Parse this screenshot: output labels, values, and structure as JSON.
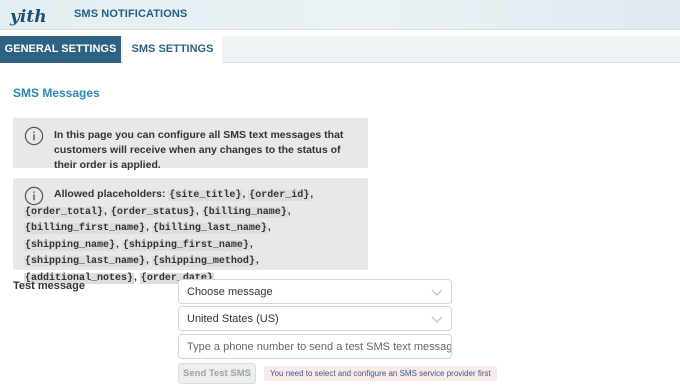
{
  "header": {
    "logo_text": "yith",
    "plugin_title": "SMS NOTIFICATIONS"
  },
  "tabs": [
    {
      "label": "GENERAL SETTINGS",
      "active": false
    },
    {
      "label": "SMS SETTINGS",
      "active": true
    }
  ],
  "section": {
    "title": "SMS Messages"
  },
  "notices": {
    "info": "In this page you can configure all SMS text messages that customers will receive when any changes to the status of their order is applied.",
    "placeholders_label": "Allowed placeholders:",
    "placeholders": [
      "{site_title}",
      "{order_id}",
      "{order_total}",
      "{order_status}",
      "{billing_name}",
      "{billing_first_name}",
      "{billing_last_name}",
      "{shipping_name}",
      "{shipping_first_name}",
      "{shipping_last_name}",
      "{shipping_method}",
      "{additional_notes}",
      "{order_date}"
    ]
  },
  "test": {
    "label": "Test message",
    "message_select": "Choose message",
    "country_select": "United States (US)",
    "phone_placeholder": "Type a phone number to send a test SMS text message",
    "send_button": "Send Test SMS",
    "warning": "You need to select and configure an SMS service provider first"
  },
  "colors": {
    "accent": "#2e6283",
    "section_title": "#2e88b0",
    "notice_bg": "#e7e8e8",
    "warning_bg": "#fbeaea"
  },
  "icons": {
    "info": "info-circle-icon",
    "dropdown": "chevron-down-icon"
  }
}
